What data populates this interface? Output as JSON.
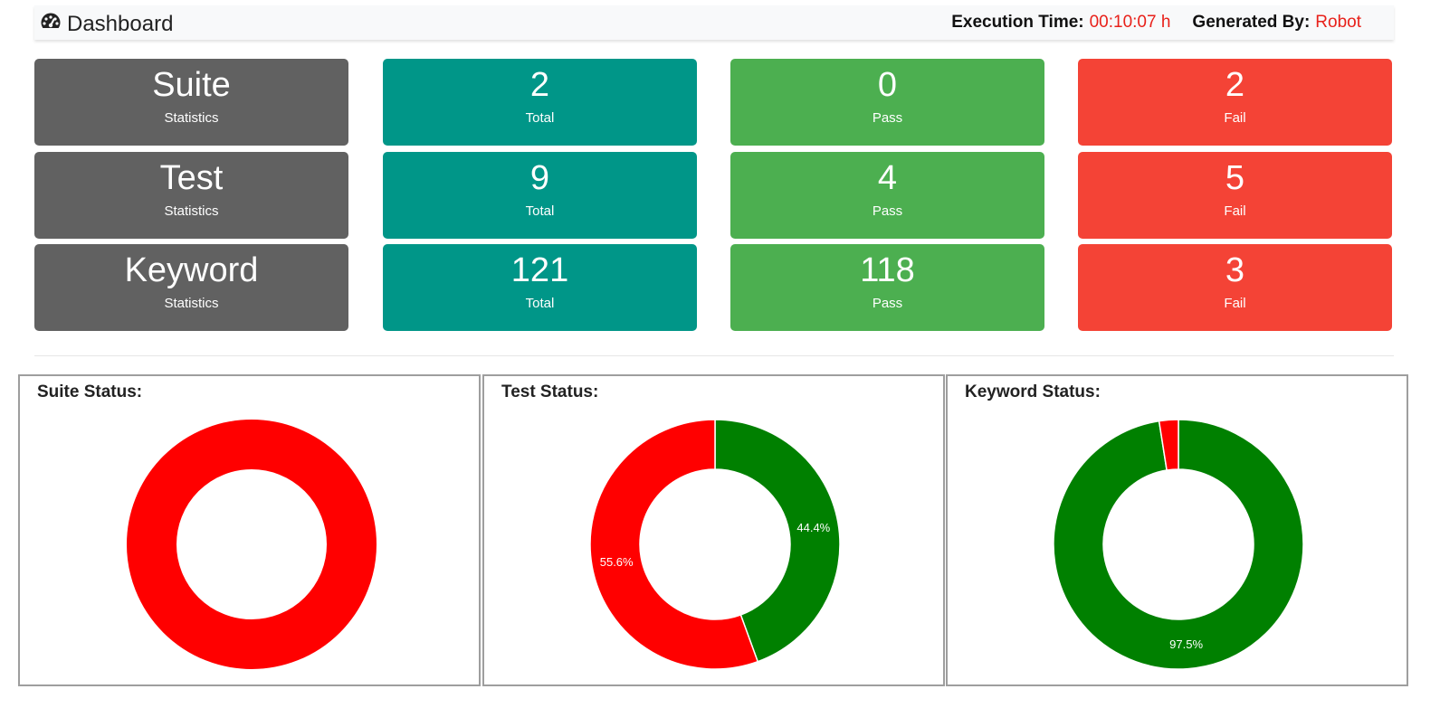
{
  "header": {
    "title": "Dashboard",
    "icon": "dashboard-icon",
    "execution_time_label": "Execution Time:",
    "execution_time_value": "00:10:07 h",
    "generated_by_label": "Generated By:",
    "generated_by_value": "Robot"
  },
  "stats": [
    {
      "name": "Suite",
      "subtitle": "Statistics",
      "total": "2",
      "total_label": "Total",
      "pass": "0",
      "pass_label": "Pass",
      "fail": "2",
      "fail_label": "Fail"
    },
    {
      "name": "Test",
      "subtitle": "Statistics",
      "total": "9",
      "total_label": "Total",
      "pass": "4",
      "pass_label": "Pass",
      "fail": "5",
      "fail_label": "Fail"
    },
    {
      "name": "Keyword",
      "subtitle": "Statistics",
      "total": "121",
      "total_label": "Total",
      "pass": "118",
      "pass_label": "Pass",
      "fail": "3",
      "fail_label": "Fail"
    }
  ],
  "colors": {
    "header_text": "#222222",
    "accent_red_text": "#e8211a",
    "card_grey": "#616161",
    "card_teal": "#009688",
    "card_green": "#4caf50",
    "card_red": "#f44336",
    "chart_pass": "#008000",
    "chart_fail": "#ff0000"
  },
  "chart_data": [
    {
      "type": "pie",
      "title": "Suite Status:",
      "categories": [
        "Pass",
        "Fail"
      ],
      "values": [
        0,
        2
      ],
      "colors": [
        "#008000",
        "#ff0000"
      ],
      "labels": [
        "",
        ""
      ]
    },
    {
      "type": "pie",
      "title": "Test Status:",
      "categories": [
        "Pass",
        "Fail"
      ],
      "values": [
        4,
        5
      ],
      "colors": [
        "#008000",
        "#ff0000"
      ],
      "labels": [
        "44.4%",
        "55.6%"
      ]
    },
    {
      "type": "pie",
      "title": "Keyword Status:",
      "categories": [
        "Pass",
        "Fail"
      ],
      "values": [
        118,
        3
      ],
      "colors": [
        "#008000",
        "#ff0000"
      ],
      "labels": [
        "97.5%",
        ""
      ]
    }
  ]
}
